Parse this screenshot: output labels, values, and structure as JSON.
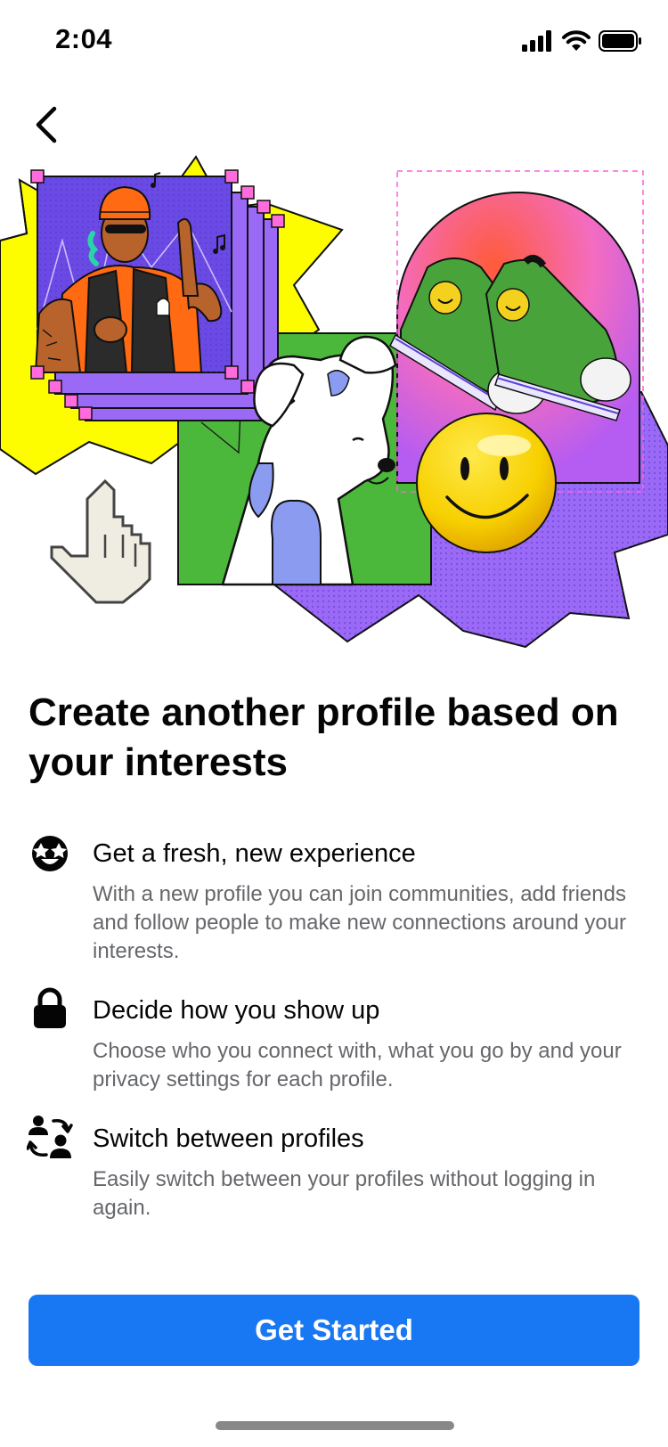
{
  "status_bar": {
    "time": "2:04",
    "icons": [
      "cellular-signal-icon",
      "wifi-icon",
      "battery-icon"
    ]
  },
  "nav": {
    "back_icon": "chevron-left-icon"
  },
  "hero": {
    "illustration": "collage-illustration"
  },
  "headline": "Create another profile based on your interests",
  "features": [
    {
      "icon": "star-eyes-face-icon",
      "title": "Get a fresh, new experience",
      "description": "With a new profile you can join communities, add friends and follow people to make new connections around your interests."
    },
    {
      "icon": "lock-icon",
      "title": "Decide how you show up",
      "description": "Choose who you connect with, what you go by and your privacy settings for each profile."
    },
    {
      "icon": "switch-profiles-icon",
      "title": "Switch between profiles",
      "description": "Easily switch between your profiles without logging in again."
    }
  ],
  "cta": {
    "label": "Get Started"
  },
  "colors": {
    "primary": "#1877f2",
    "text_primary": "#050505",
    "text_secondary": "#65676b",
    "illustration_yellow": "#fdfd00",
    "illustration_purple": "#9a6af7",
    "illustration_green": "#4cb83b"
  }
}
